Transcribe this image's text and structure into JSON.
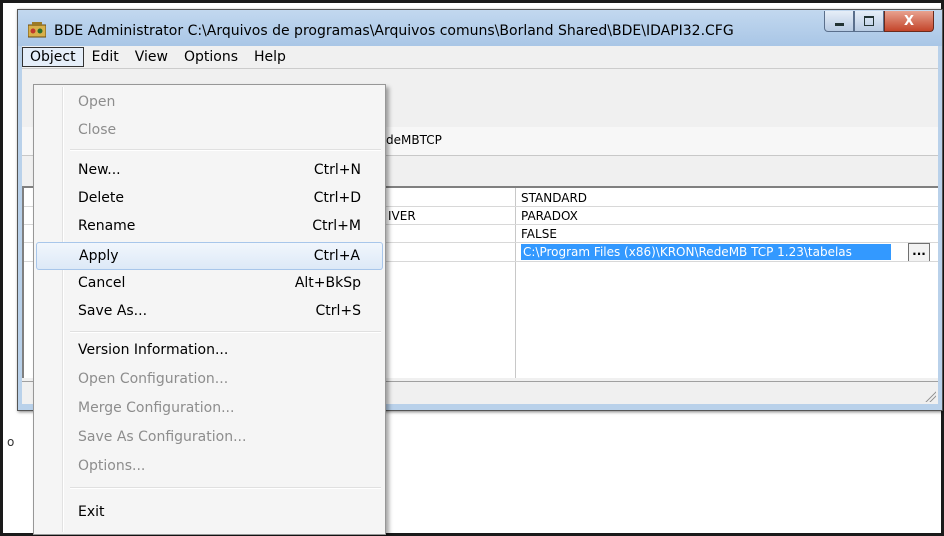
{
  "window": {
    "title": "BDE Administrator  C:\\Arquivos de programas\\Arquivos comuns\\Borland Shared\\BDE\\IDAPI32.CFG",
    "caption_close": "X"
  },
  "menubar": {
    "items": [
      "Object",
      "Edit",
      "View",
      "Options",
      "Help"
    ]
  },
  "name_field": {
    "value": "deMBTCP"
  },
  "grid": {
    "rows": [
      {
        "key": "",
        "value": "STANDARD"
      },
      {
        "key": "IVER",
        "value": "PARADOX"
      },
      {
        "key": "",
        "value": "FALSE"
      },
      {
        "key": "",
        "value": "C:\\Program Files (x86)\\KRON\\RedeMB TCP 1.23\\tabelas"
      }
    ],
    "ellipsis": "..."
  },
  "object_menu": {
    "items": [
      {
        "label": "Open",
        "shortcut": "",
        "enabled": false
      },
      {
        "label": "Close",
        "shortcut": "",
        "enabled": false
      },
      {
        "label": "New...",
        "shortcut": "Ctrl+N",
        "enabled": true
      },
      {
        "label": "Delete",
        "shortcut": "Ctrl+D",
        "enabled": true
      },
      {
        "label": "Rename",
        "shortcut": "Ctrl+M",
        "enabled": true
      },
      {
        "label": "Apply",
        "shortcut": "Ctrl+A",
        "enabled": true,
        "highlighted": true
      },
      {
        "label": "Cancel",
        "shortcut": "Alt+BkSp",
        "enabled": true
      },
      {
        "label": "Save As...",
        "shortcut": "Ctrl+S",
        "enabled": true
      },
      {
        "label": "Version Information...",
        "shortcut": "",
        "enabled": true
      },
      {
        "label": "Open Configuration...",
        "shortcut": "",
        "enabled": false
      },
      {
        "label": "Merge Configuration...",
        "shortcut": "",
        "enabled": false
      },
      {
        "label": "Save As Configuration...",
        "shortcut": "",
        "enabled": false
      },
      {
        "label": "Options...",
        "shortcut": "",
        "enabled": false
      },
      {
        "label": "Exit",
        "shortcut": "",
        "enabled": true
      }
    ]
  },
  "background_fragment": {
    "text": "o"
  },
  "colors": {
    "selection": "#3399ff",
    "hover_border": "#a8c6ea",
    "titlebar": "#b9d1ea"
  }
}
